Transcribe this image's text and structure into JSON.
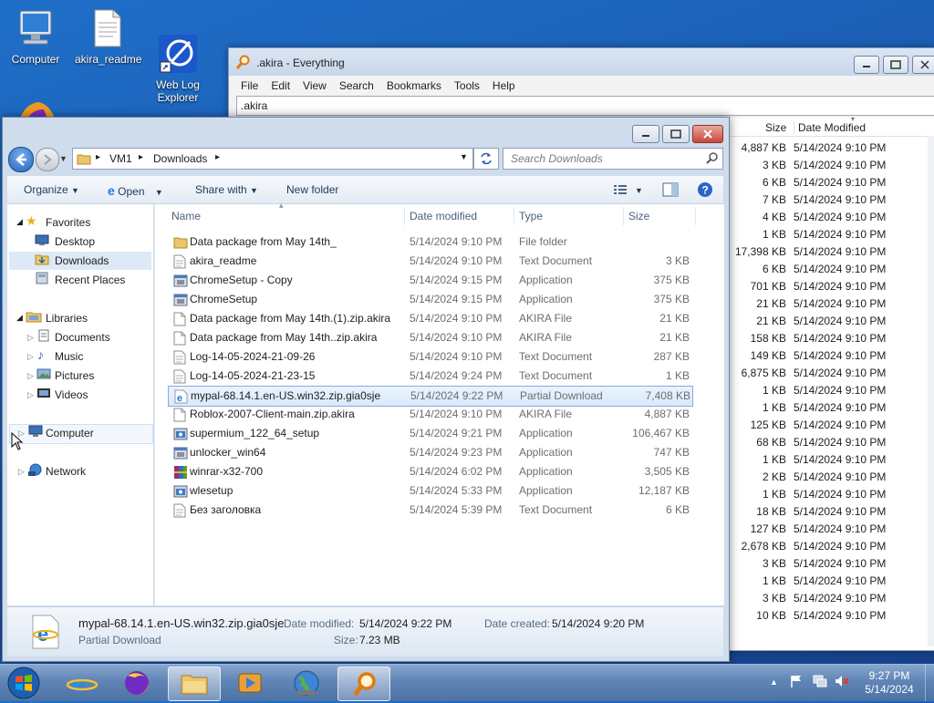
{
  "desktop": {
    "icons": [
      {
        "label": "Computer",
        "icon": "computer-icon"
      },
      {
        "label": "akira_readme",
        "icon": "text-file-icon"
      },
      {
        "label": "Web Log\nExplorer",
        "icon": "web-log-explorer-icon"
      }
    ]
  },
  "everything": {
    "title": ".akira - Everything",
    "menu": [
      "File",
      "Edit",
      "View",
      "Search",
      "Bookmarks",
      "Tools",
      "Help"
    ],
    "search_value": ".akira",
    "columns": {
      "size": "Size",
      "date_modified": "Date Modified"
    },
    "rows": [
      {
        "size": "4,887 KB",
        "date": "5/14/2024 9:10 PM"
      },
      {
        "size": "3 KB",
        "date": "5/14/2024 9:10 PM"
      },
      {
        "size": "6 KB",
        "date": "5/14/2024 9:10 PM"
      },
      {
        "size": "7 KB",
        "date": "5/14/2024 9:10 PM"
      },
      {
        "size": "4 KB",
        "date": "5/14/2024 9:10 PM"
      },
      {
        "size": "1 KB",
        "date": "5/14/2024 9:10 PM"
      },
      {
        "size": "17,398 KB",
        "date": "5/14/2024 9:10 PM"
      },
      {
        "size": "6 KB",
        "date": "5/14/2024 9:10 PM"
      },
      {
        "size": "701 KB",
        "date": "5/14/2024 9:10 PM"
      },
      {
        "size": "21 KB",
        "date": "5/14/2024 9:10 PM"
      },
      {
        "size": "21 KB",
        "date": "5/14/2024 9:10 PM"
      },
      {
        "size": "158 KB",
        "date": "5/14/2024 9:10 PM"
      },
      {
        "size": "149 KB",
        "date": "5/14/2024 9:10 PM"
      },
      {
        "size": "6,875 KB",
        "date": "5/14/2024 9:10 PM"
      },
      {
        "size": "1 KB",
        "date": "5/14/2024 9:10 PM"
      },
      {
        "size": "1 KB",
        "date": "5/14/2024 9:10 PM"
      },
      {
        "size": "125 KB",
        "date": "5/14/2024 9:10 PM"
      },
      {
        "size": "68 KB",
        "date": "5/14/2024 9:10 PM"
      },
      {
        "size": "1 KB",
        "date": "5/14/2024 9:10 PM"
      },
      {
        "size": "2 KB",
        "date": "5/14/2024 9:10 PM"
      },
      {
        "size": "1 KB",
        "date": "5/14/2024 9:10 PM"
      },
      {
        "size": "18 KB",
        "date": "5/14/2024 9:10 PM"
      },
      {
        "size": "127 KB",
        "date": "5/14/2024 9:10 PM"
      },
      {
        "size": "2,678 KB",
        "date": "5/14/2024 9:10 PM"
      },
      {
        "size": "3 KB",
        "date": "5/14/2024 9:10 PM"
      },
      {
        "size": "1 KB",
        "date": "5/14/2024 9:10 PM"
      },
      {
        "size": "3 KB",
        "date": "5/14/2024 9:10 PM"
      },
      {
        "size": "10 KB",
        "date": "5/14/2024 9:10 PM"
      }
    ]
  },
  "explorer": {
    "breadcrumb": [
      "VM1",
      "Downloads"
    ],
    "search_placeholder": "Search Downloads",
    "toolbar": {
      "organize": "Organize",
      "open": "Open",
      "share_with": "Share with",
      "new_folder": "New folder"
    },
    "nav": {
      "favorites": "Favorites",
      "desktop": "Desktop",
      "downloads": "Downloads",
      "recent_places": "Recent Places",
      "libraries": "Libraries",
      "documents": "Documents",
      "music": "Music",
      "pictures": "Pictures",
      "videos": "Videos",
      "computer": "Computer",
      "network": "Network"
    },
    "columns": {
      "name": "Name",
      "date_modified": "Date modified",
      "type": "Type",
      "size": "Size"
    },
    "files": [
      {
        "name": "Data package from May 14th_",
        "date": "5/14/2024 9:10 PM",
        "type": "File folder",
        "size": "",
        "icon": "folder-icon"
      },
      {
        "name": "akira_readme",
        "date": "5/14/2024 9:10 PM",
        "type": "Text Document",
        "size": "3 KB",
        "icon": "text-file-icon"
      },
      {
        "name": "ChromeSetup - Copy",
        "date": "5/14/2024 9:15 PM",
        "type": "Application",
        "size": "375 KB",
        "icon": "application-icon"
      },
      {
        "name": "ChromeSetup",
        "date": "5/14/2024 9:15 PM",
        "type": "Application",
        "size": "375 KB",
        "icon": "application-icon"
      },
      {
        "name": "Data package from May 14th.(1).zip.akira",
        "date": "5/14/2024 9:10 PM",
        "type": "AKIRA File",
        "size": "21 KB",
        "icon": "blank-file-icon"
      },
      {
        "name": "Data package from May 14th..zip.akira",
        "date": "5/14/2024 9:10 PM",
        "type": "AKIRA File",
        "size": "21 KB",
        "icon": "blank-file-icon"
      },
      {
        "name": "Log-14-05-2024-21-09-26",
        "date": "5/14/2024 9:10 PM",
        "type": "Text Document",
        "size": "287 KB",
        "icon": "text-file-icon"
      },
      {
        "name": "Log-14-05-2024-21-23-15",
        "date": "5/14/2024 9:24 PM",
        "type": "Text Document",
        "size": "1 KB",
        "icon": "text-file-icon"
      },
      {
        "name": "mypal-68.14.1.en-US.win32.zip.gia0sje",
        "date": "5/14/2024 9:22 PM",
        "type": "Partial Download",
        "size": "7,408 KB",
        "icon": "ie-file-icon",
        "selected": true
      },
      {
        "name": "Roblox-2007-Client-main.zip.akira",
        "date": "5/14/2024 9:10 PM",
        "type": "AKIRA File",
        "size": "4,887 KB",
        "icon": "blank-file-icon"
      },
      {
        "name": "supermium_122_64_setup",
        "date": "5/14/2024 9:21 PM",
        "type": "Application",
        "size": "106,467 KB",
        "icon": "installer-icon"
      },
      {
        "name": "unlocker_win64",
        "date": "5/14/2024 9:23 PM",
        "type": "Application",
        "size": "747 KB",
        "icon": "application-icon"
      },
      {
        "name": "winrar-x32-700",
        "date": "5/14/2024 6:02 PM",
        "type": "Application",
        "size": "3,505 KB",
        "icon": "winrar-icon"
      },
      {
        "name": "wlesetup",
        "date": "5/14/2024 5:33 PM",
        "type": "Application",
        "size": "12,187 KB",
        "icon": "installer-icon"
      },
      {
        "name": "Без заголовка",
        "date": "5/14/2024 5:39 PM",
        "type": "Text Document",
        "size": "6 KB",
        "icon": "text-file-icon"
      }
    ],
    "details": {
      "filename": "mypal-68.14.1.en-US.win32.zip.gia0sje",
      "type": "Partial Download",
      "date_modified_label": "Date modified:",
      "date_modified": "5/14/2024 9:22 PM",
      "date_created_label": "Date created:",
      "date_created": "5/14/2024 9:20 PM",
      "size_label": "Size:",
      "size": "7.23 MB"
    }
  },
  "taskbar": {
    "apps": [
      "start-orb-icon",
      "internet-explorer-icon",
      "firefox-icon",
      "file-explorer-icon",
      "media-player-icon",
      "globe-icon",
      "everything-search-icon"
    ],
    "time": "9:27 PM",
    "date": "5/14/2024"
  }
}
